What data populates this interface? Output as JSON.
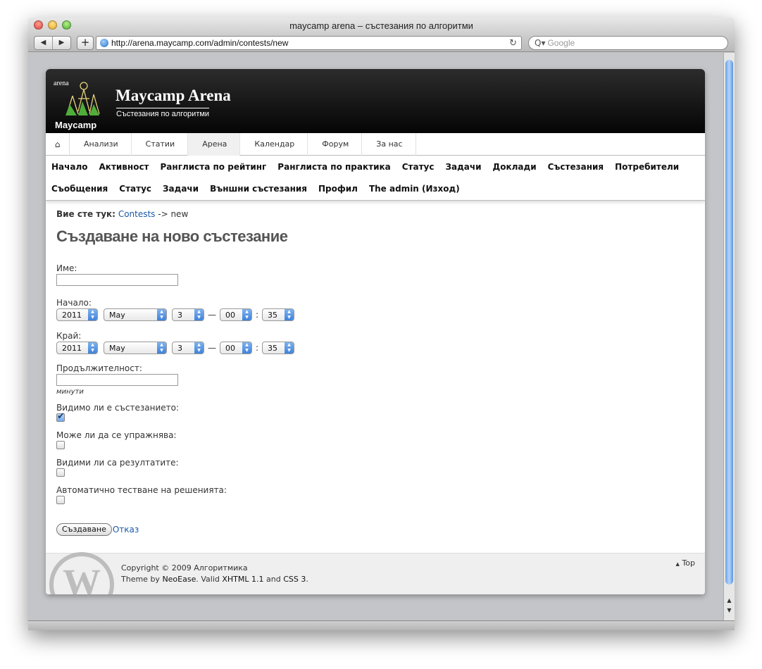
{
  "window": {
    "title": "maycamp arena – състезания по алгоритми"
  },
  "browser": {
    "back_icon": "◀",
    "forward_icon": "▶",
    "add_icon": "+",
    "url": "http://arena.maycamp.com/admin/contests/new",
    "reload_icon": "↻",
    "search_placeholder": "Google",
    "search_icon": "Q▾"
  },
  "site": {
    "logo_top": "arena",
    "logo_bottom": "Maycamp",
    "title": "Maycamp Arena",
    "subtitle": "Състезания по алгоритми"
  },
  "topnav": {
    "home_icon": "⌂",
    "items": [
      "Анализи",
      "Статии",
      "Арена",
      "Календар",
      "Форум",
      "За нас"
    ],
    "active": "Арена"
  },
  "menu": {
    "row1": [
      "Начало",
      "Активност",
      "Ранглиста по рейтинг",
      "Ранглиста по практика",
      "Статус",
      "Задачи",
      "Доклади",
      "Състезания",
      "Потребители"
    ],
    "row2": [
      "Съобщения",
      "Статус",
      "Задачи",
      "Външни състезания",
      "Профил",
      "The admin (Изход)"
    ]
  },
  "breadcrumb": {
    "label": "Вие сте тук:",
    "link": "Contests",
    "rest": " -> new"
  },
  "heading": "Създаване на ново състезание",
  "form": {
    "name_label": "Име:",
    "name_value": "",
    "start_label": "Начало:",
    "end_label": "Край:",
    "start": {
      "year": "2011",
      "month": "May",
      "day": "3",
      "hour": "00",
      "minute": "35"
    },
    "end": {
      "year": "2011",
      "month": "May",
      "day": "3",
      "hour": "00",
      "minute": "35"
    },
    "dash": "—",
    "colon": ":",
    "duration_label": "Продължителност:",
    "duration_value": "",
    "duration_hint": "минути",
    "visible_label": "Видимо ли е състезанието:",
    "visible_checked": true,
    "practice_label": "Може ли да се упражнява:",
    "practice_checked": false,
    "results_label": "Видими ли са резултатите:",
    "results_checked": false,
    "autotest_label": "Автоматично тестване на решенията:",
    "autotest_checked": false,
    "submit_label": "Създаване",
    "cancel_label": "Отказ"
  },
  "footer": {
    "copyright": "Copyright © 2009 Алгоритмика",
    "theme_prefix": "Theme by ",
    "theme_link": "NeoEase",
    "valid_prefix": ". Valid ",
    "xhtml_link": "XHTML 1.1",
    "and": " and ",
    "css_link": "CSS 3",
    "period": ".",
    "top_label": "Top",
    "top_icon": "▲",
    "logo_glyph": "W"
  },
  "colors": {
    "accent": "#1a5aa6",
    "header_bg": "#0a0a0a",
    "scroll_thumb": "#6ca1e8"
  }
}
